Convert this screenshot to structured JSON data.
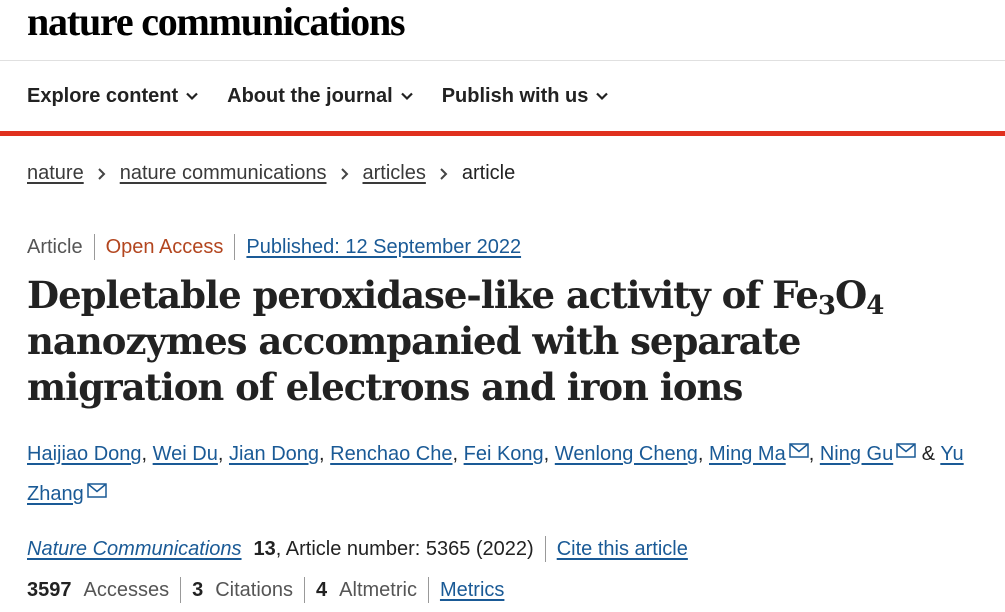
{
  "header": {
    "logo": "nature communications"
  },
  "nav": {
    "items": [
      {
        "label": "Explore content"
      },
      {
        "label": "About the journal"
      },
      {
        "label": "Publish with us"
      }
    ]
  },
  "breadcrumb": {
    "items": [
      "nature",
      "nature communications",
      "articles"
    ],
    "current": "article"
  },
  "meta": {
    "type": "Article",
    "access": "Open Access",
    "published": "Published: 12 September 2022"
  },
  "article": {
    "title_part1": "Depletable peroxidase-like activity of Fe",
    "title_sub1": "3",
    "title_part2": "O",
    "title_sub2": "4",
    "title_part3": " nanozymes accompanied with separate migration of electrons and iron ions"
  },
  "authors": {
    "names": [
      "Haijiao Dong",
      "Wei Du",
      "Jian Dong",
      "Renchao Che",
      "Fei Kong",
      "Wenlong Cheng",
      "Ming Ma",
      "Ning Gu",
      "Yu Zhang"
    ],
    "ampersand": "&"
  },
  "journal": {
    "name": "Nature Communications",
    "volume": "13",
    "article_number": ", Article number: 5365 (2022)",
    "cite_label": "Cite this article"
  },
  "metrics": {
    "accesses_count": "3597",
    "accesses_label": "Accesses",
    "citations_count": "3",
    "citations_label": "Citations",
    "altmetric_count": "4",
    "altmetric_label": "Altmetric",
    "metrics_link": "Metrics"
  },
  "colors": {
    "accent_red": "#e0301e",
    "link_blue": "#1a5a96",
    "open_access": "#b3461f"
  }
}
